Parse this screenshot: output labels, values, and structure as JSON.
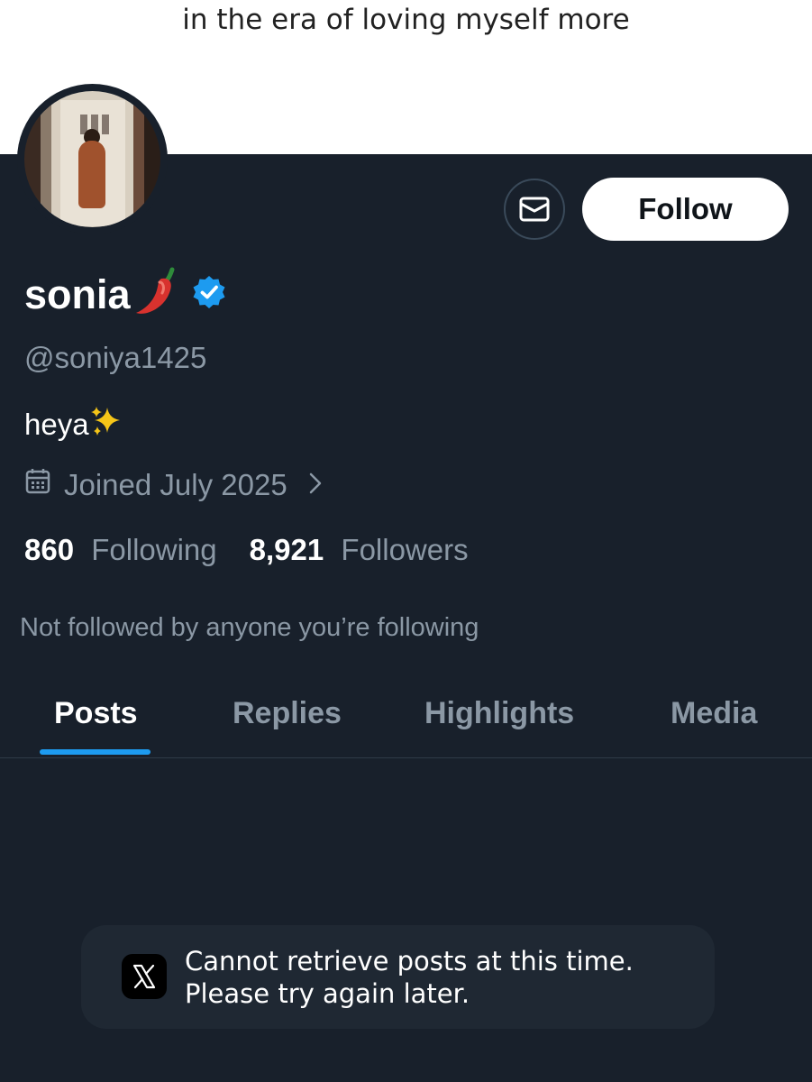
{
  "banner": {
    "text": "in the era of loving myself more"
  },
  "profile": {
    "name": "sonia",
    "name_emoji": "chili-pepper",
    "handle": "@soniya1425",
    "bio": "heya",
    "bio_emoji": "sparkles",
    "joined": "Joined July 2025",
    "following_count": "860",
    "following_label": "Following",
    "followers_count": "8,921",
    "followers_label": "Followers",
    "not_followed_text": "Not followed by anyone you’re following"
  },
  "actions": {
    "message_icon": "envelope-icon",
    "follow_label": "Follow"
  },
  "tabs": [
    {
      "label": "Posts",
      "active": true
    },
    {
      "label": "Replies",
      "active": false
    },
    {
      "label": "Highlights",
      "active": false
    },
    {
      "label": "Media",
      "active": false
    }
  ],
  "toast": {
    "line1": "Cannot retrieve posts at this time.",
    "line2": "Please try again later."
  },
  "colors": {
    "background": "#18202b",
    "accent": "#1d9bf0",
    "muted_text": "#8b98a5"
  }
}
